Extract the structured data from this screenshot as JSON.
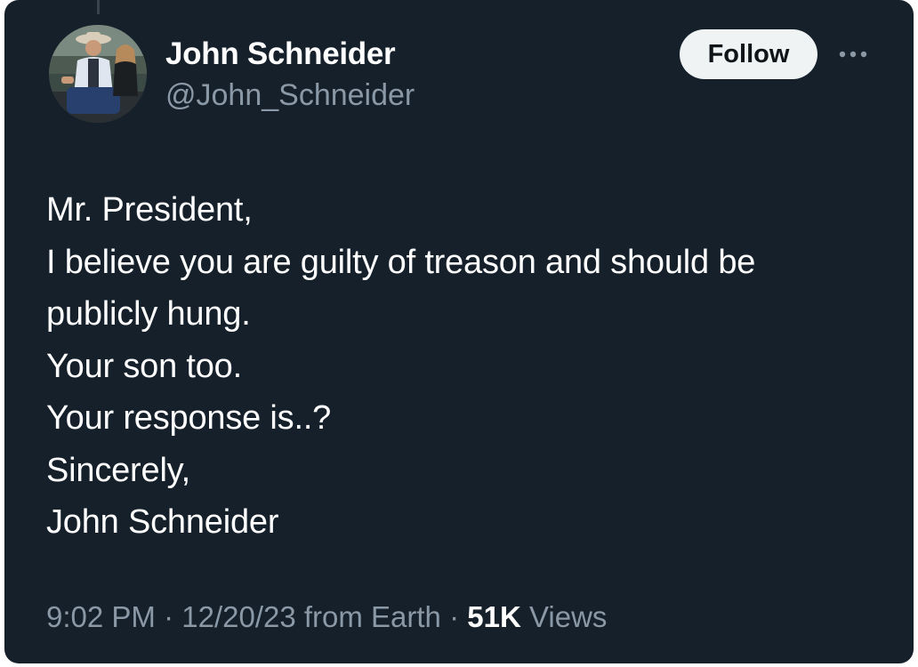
{
  "author": {
    "display_name": "John Schneider",
    "handle": "@John_Schneider"
  },
  "actions": {
    "follow_label": "Follow",
    "more_icon": "more-horizontal-icon"
  },
  "tweet": {
    "lines": [
      "Mr. President,",
      "I believe you are guilty of treason and should be",
      "publicly hung.",
      "Your son too.",
      "Your response is..?",
      "Sincerely,",
      "John Schneider"
    ]
  },
  "meta": {
    "time": "9:02 PM",
    "sep1": " · ",
    "date": "12/20/23",
    "source": " from Earth",
    "sep2": " · ",
    "views_count": "51K",
    "views_label": " Views"
  },
  "colors": {
    "background": "#15202b",
    "text_primary": "#ffffff",
    "text_secondary": "#8b98a5",
    "follow_button_bg": "#eff3f4"
  }
}
